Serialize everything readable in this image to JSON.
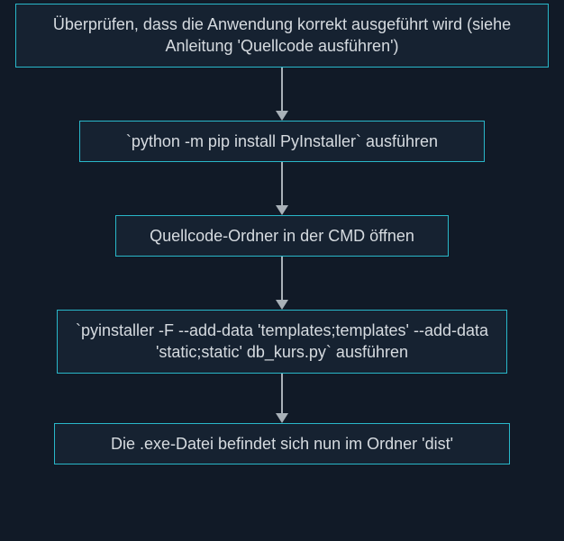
{
  "diagram": {
    "type": "flowchart",
    "direction": "top-down",
    "colors": {
      "background": "#111a27",
      "node_border": "#29b7c9",
      "node_bg": "#162231",
      "text": "#d6dbe0",
      "arrow": "#a9b1b8"
    },
    "nodes": [
      {
        "id": "n0",
        "text": "Überprüfen, dass die Anwendung korrekt ausgeführt wird (siehe Anleitung 'Quellcode ausführen')"
      },
      {
        "id": "n1",
        "text": "`python -m pip install PyInstaller` ausführen"
      },
      {
        "id": "n2",
        "text": "Quellcode-Ordner in der CMD öffnen"
      },
      {
        "id": "n3",
        "text": "`pyinstaller -F --add-data 'templates;templates' --add-data 'static;static' db_kurs.py` ausführen"
      },
      {
        "id": "n4",
        "text": "Die .exe-Datei befindet sich nun im Ordner 'dist'"
      }
    ],
    "edges": [
      {
        "from": "n0",
        "to": "n1"
      },
      {
        "from": "n1",
        "to": "n2"
      },
      {
        "from": "n2",
        "to": "n3"
      },
      {
        "from": "n3",
        "to": "n4"
      }
    ]
  }
}
